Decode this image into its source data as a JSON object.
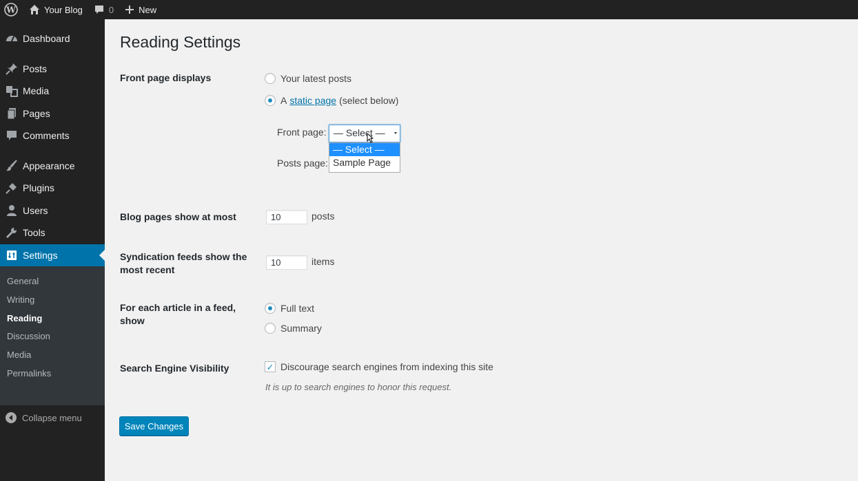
{
  "adminbar": {
    "site_name": "Your Blog",
    "comments_count": "0",
    "new_label": "New"
  },
  "sidebar": {
    "items": [
      {
        "label": "Dashboard",
        "icon": "dashboard-icon"
      },
      {
        "label": "Posts",
        "icon": "pin-icon"
      },
      {
        "label": "Media",
        "icon": "media-icon"
      },
      {
        "label": "Pages",
        "icon": "pages-icon"
      },
      {
        "label": "Comments",
        "icon": "comment-icon"
      },
      {
        "label": "Appearance",
        "icon": "brush-icon"
      },
      {
        "label": "Plugins",
        "icon": "plug-icon"
      },
      {
        "label": "Users",
        "icon": "user-icon"
      },
      {
        "label": "Tools",
        "icon": "wrench-icon"
      },
      {
        "label": "Settings",
        "icon": "settings-icon"
      }
    ],
    "submenu": [
      "General",
      "Writing",
      "Reading",
      "Discussion",
      "Media",
      "Permalinks"
    ],
    "active_submenu": "Reading",
    "collapse_label": "Collapse menu"
  },
  "page": {
    "title": "Reading Settings",
    "front_page_displays": {
      "label": "Front page displays",
      "option_latest": "Your latest posts",
      "option_static_prefix": "A",
      "option_static_link": "static page",
      "option_static_suffix": "(select below)",
      "selected": "static"
    },
    "front_page": {
      "label": "Front page:",
      "value": "— Select —"
    },
    "posts_page": {
      "label": "Posts page:"
    },
    "dropdown_options": [
      "— Select —",
      "Sample Page"
    ],
    "dropdown_highlighted": "— Select —",
    "blog_pages": {
      "label": "Blog pages show at most",
      "value": "10",
      "unit": "posts"
    },
    "syndication": {
      "label": "Syndication feeds show the most recent",
      "value": "10",
      "unit": "items"
    },
    "feed_article": {
      "label": "For each article in a feed, show",
      "option_full": "Full text",
      "option_summary": "Summary",
      "selected": "full"
    },
    "search_visibility": {
      "label": "Search Engine Visibility",
      "checkbox_label": "Discourage search engines from indexing this site",
      "checked": true,
      "description": "It is up to search engines to honor this request."
    },
    "save_button": "Save Changes"
  },
  "colors": {
    "accent": "#0073aa",
    "button": "#0085ba",
    "sidebar": "#222222",
    "highlight": "#1e90ff"
  }
}
